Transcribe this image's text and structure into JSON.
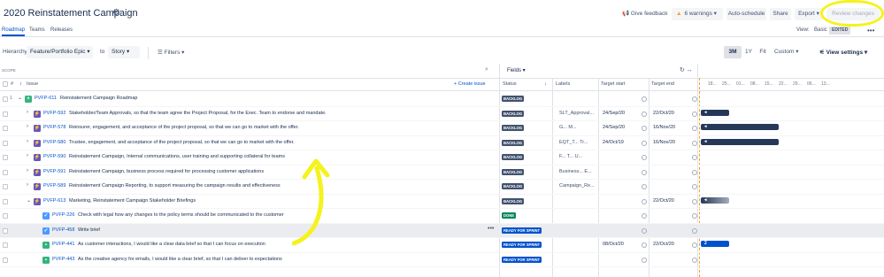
{
  "header": {
    "title": "2020 Reinstatement Campaign",
    "give_feedback": "Give feedback",
    "warnings": "6 warnings",
    "auto_schedule": "Auto-schedule",
    "share": "Share",
    "export": "Export",
    "review_changes": "Review changes"
  },
  "nav": {
    "tabs": [
      "Roadmap",
      "Teams",
      "Releases"
    ],
    "view_label": "View:",
    "view_value": "Basic",
    "edited": "EDITED"
  },
  "hierarchy": {
    "label": "Hierarchy:",
    "from": "Feature/Portfolio Epic",
    "to_label": "to",
    "to": "Story",
    "filters": "Filters",
    "zoom": [
      "3M",
      "1Y",
      "Fit"
    ],
    "zoom_active": "3M",
    "custom": "Custom",
    "view_settings": "View settings"
  },
  "scope": {
    "label": "SCOPE",
    "fields": "Fields"
  },
  "columns": {
    "issue": "Issue",
    "create_issue": "+ Create issue",
    "status": "Status",
    "labels": "Labels",
    "target_start": "Target start",
    "target_end": "Target end"
  },
  "timeline_ticks": [
    "18...",
    "25...",
    "01...",
    "08...",
    "15...",
    "22...",
    "29...",
    "06...",
    "13..."
  ],
  "rows": [
    {
      "num": "1",
      "type": "initiative",
      "key": "PVFP-611",
      "summary": "Reinstatement Campaign Roadmap",
      "status": "BACKLOG",
      "status_kind": "backlog",
      "labels": "",
      "start": "",
      "end": ""
    },
    {
      "num": "",
      "type": "epic",
      "key": "PVFP-592",
      "summary": "Stakeholder/Team Approvals, so that the team agree the Project Proposal, for the Exec. Team to endorse and mandate.",
      "status": "BACKLOG",
      "status_kind": "backlog",
      "labels": "SLT_Approval...",
      "start": "24/Sep/20",
      "end": "22/Oct/20"
    },
    {
      "num": "",
      "type": "epic",
      "key": "PVFP-578",
      "summary": "Reinsurer, engagement, and acceptance of the project proposal, so that we can go to market with the offer.",
      "status": "BACKLOG",
      "status_kind": "backlog",
      "labels": "G...   M...",
      "start": "24/Sep/20",
      "end": "16/Nov/20"
    },
    {
      "num": "",
      "type": "epic",
      "key": "PVFP-580",
      "summary": "Trustee, engagement, and acceptance of the project proposal, so that we can go to market with the offer.",
      "status": "BACKLOG",
      "status_kind": "backlog",
      "labels": "EQT_T...   Tr...",
      "start": "24/Oct/19",
      "end": "16/Nov/20"
    },
    {
      "num": "",
      "type": "epic",
      "key": "PVFP-590",
      "summary": "Reinstatement Campaign, Internal communications, user training and supporting collateral for teams",
      "status": "BACKLOG",
      "status_kind": "backlog",
      "labels": "F...   T...   U...",
      "start": "",
      "end": ""
    },
    {
      "num": "",
      "type": "epic",
      "key": "PVFP-591",
      "summary": "Reinstatement Campaign, business process required for processing customer applications",
      "status": "BACKLOG",
      "status_kind": "backlog",
      "labels": "Business...   E...",
      "start": "",
      "end": ""
    },
    {
      "num": "",
      "type": "epic",
      "key": "PVFP-589",
      "summary": "Reinstatement Campaign Reporting, to support measuring the campaign results and effectiveness",
      "status": "BACKLOG",
      "status_kind": "backlog",
      "labels": "Campaign_Re...",
      "start": "",
      "end": ""
    },
    {
      "num": "",
      "type": "epic",
      "key": "PVFP-613",
      "summary": "Marketing, Reinstatement Campaign Stakeholder Briefings",
      "status": "BACKLOG",
      "status_kind": "backlog",
      "labels": "",
      "start": "",
      "end": "22/Oct/20"
    },
    {
      "num": "",
      "type": "task",
      "key": "PVFP-226",
      "summary": "Check with legal how any changes to the policy terms should be communicated to the customer",
      "status": "DONE",
      "status_kind": "done",
      "labels": "",
      "start": "",
      "end": ""
    },
    {
      "num": "",
      "type": "task",
      "key": "PVFP-458",
      "summary": "Write brief",
      "status": "READY FOR SPRINT",
      "status_kind": "ready",
      "labels": "",
      "start": "",
      "end": ""
    },
    {
      "num": "",
      "type": "story",
      "key": "PVFP-441",
      "summary": "As customer interactions, I would like a clear data brief so that I can focus on execution",
      "status": "READY FOR SPRINT",
      "status_kind": "ready",
      "labels": "",
      "start": "08/Oct/20",
      "end": "22/Oct/20",
      "bar_label": "2"
    },
    {
      "num": "",
      "type": "story",
      "key": "PVFP-443",
      "summary": "As the creative agency for emails, I would like a clear brief, so that I can deliver to expectations",
      "status": "READY FOR SPRINT",
      "status_kind": "ready",
      "labels": "",
      "start": "",
      "end": ""
    }
  ],
  "colors": {
    "accent": "#0052cc",
    "annotation": "#f5f21d",
    "today_line": "#ff991f"
  }
}
